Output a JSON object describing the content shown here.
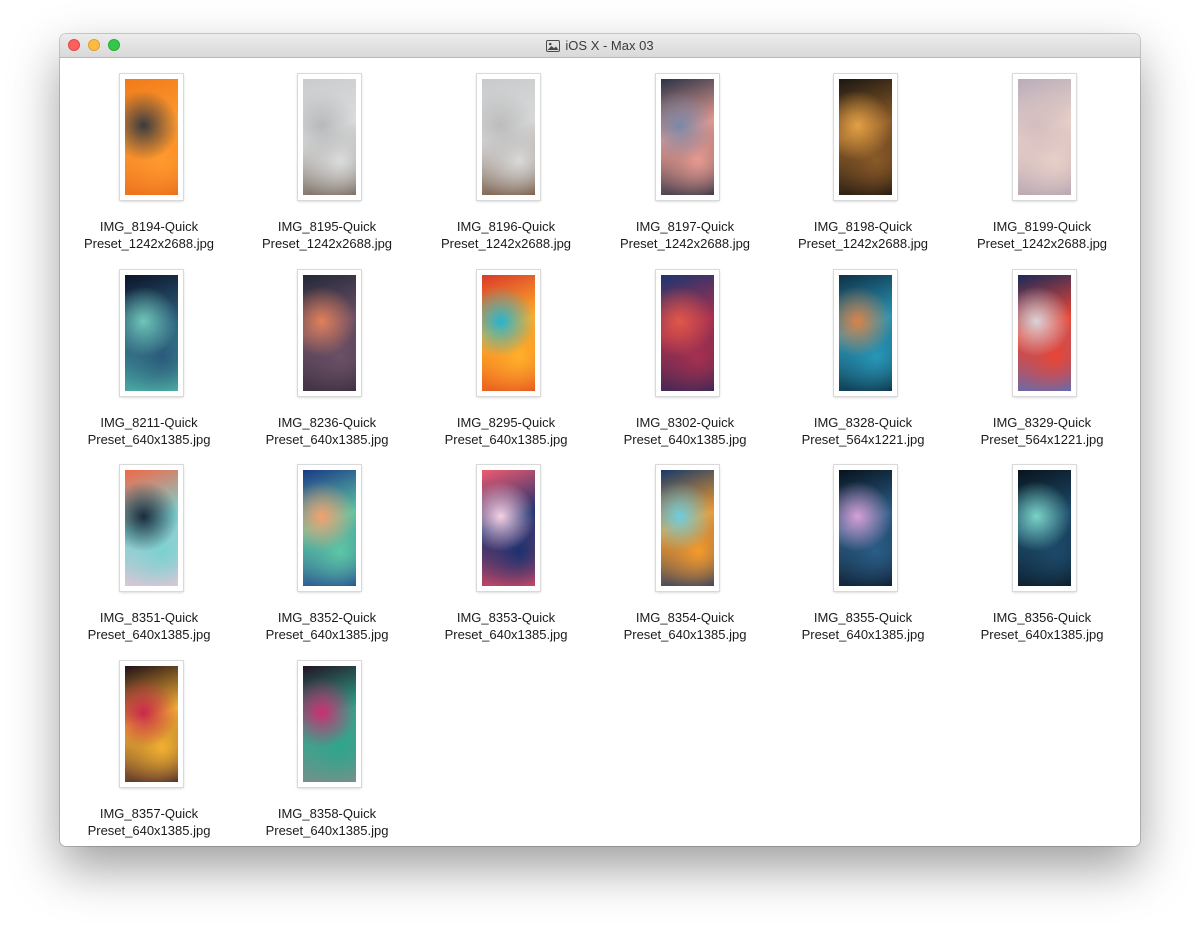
{
  "window": {
    "title": "iOS X - Max 03",
    "title_icon": "image-file-icon"
  },
  "items": [
    {
      "line1": "IMG_8194-Quick",
      "line2": "Preset_1242x2688.jpg",
      "colors": [
        "#f07a1a",
        "#ff9a2e",
        "#3a3a40",
        "#e8661a"
      ]
    },
    {
      "line1": "IMG_8195-Quick",
      "line2": "Preset_1242x2688.jpg",
      "colors": [
        "#c9cbcd",
        "#dadcdd",
        "#b8b9ba",
        "#6b5a4c"
      ]
    },
    {
      "line1": "IMG_8196-Quick",
      "line2": "Preset_1242x2688.jpg",
      "colors": [
        "#c8cacb",
        "#d8d9da",
        "#bcbcbc",
        "#6a4a32"
      ]
    },
    {
      "line1": "IMG_8197-Quick",
      "line2": "Preset_1242x2688.jpg",
      "colors": [
        "#2b3446",
        "#e69a90",
        "#7a88a8",
        "#1f2a3d"
      ]
    },
    {
      "line1": "IMG_8198-Quick",
      "line2": "Preset_1242x2688.jpg",
      "colors": [
        "#1c1712",
        "#8a5a28",
        "#e3a045",
        "#15110e"
      ]
    },
    {
      "line1": "IMG_8199-Quick",
      "line2": "Preset_1242x2688.jpg",
      "colors": [
        "#b9adba",
        "#e8cfc8",
        "#d3bdbf",
        "#ae9fae"
      ]
    },
    {
      "line1": "IMG_8211-Quick",
      "line2": "Preset_640x1385.jpg",
      "colors": [
        "#0c1428",
        "#2a5a7a",
        "#6fc6b9",
        "#54bfae"
      ]
    },
    {
      "line1": "IMG_8236-Quick",
      "line2": "Preset_640x1385.jpg",
      "colors": [
        "#232838",
        "#6b5066",
        "#e0805a",
        "#35293a"
      ]
    },
    {
      "line1": "IMG_8295-Quick",
      "line2": "Preset_640x1385.jpg",
      "colors": [
        "#d93a2a",
        "#ffb02a",
        "#27b3cf",
        "#e4481f"
      ]
    },
    {
      "line1": "IMG_8302-Quick",
      "line2": "Preset_640x1385.jpg",
      "colors": [
        "#1d3570",
        "#a6304f",
        "#e1574a",
        "#2c2657"
      ]
    },
    {
      "line1": "IMG_8328-Quick",
      "line2": "Preset_564x1221.jpg",
      "colors": [
        "#0e3147",
        "#2896b7",
        "#d8834a",
        "#0a2638"
      ]
    },
    {
      "line1": "IMG_8329-Quick",
      "line2": "Preset_564x1221.jpg",
      "colors": [
        "#1b2a59",
        "#e84535",
        "#d9d3d8",
        "#4a73c7"
      ]
    },
    {
      "line1": "IMG_8351-Quick",
      "line2": "Preset_640x1385.jpg",
      "colors": [
        "#f06848",
        "#7bd1d0",
        "#1a2b3c",
        "#f2c4d8"
      ]
    },
    {
      "line1": "IMG_8352-Quick",
      "line2": "Preset_640x1385.jpg",
      "colors": [
        "#1b3a86",
        "#5cc7a5",
        "#f2a070",
        "#24408f"
      ]
    },
    {
      "line1": "IMG_8353-Quick",
      "line2": "Preset_640x1385.jpg",
      "colors": [
        "#f05a70",
        "#1b3270",
        "#f6d0e4",
        "#ec4c62"
      ]
    },
    {
      "line1": "IMG_8354-Quick",
      "line2": "Preset_640x1385.jpg",
      "colors": [
        "#173a6b",
        "#f49a2c",
        "#6ccde0",
        "#1b3566"
      ]
    },
    {
      "line1": "IMG_8355-Quick",
      "line2": "Preset_640x1385.jpg",
      "colors": [
        "#07121e",
        "#2a5d86",
        "#d6a0d6",
        "#0b1624"
      ]
    },
    {
      "line1": "IMG_8356-Quick",
      "line2": "Preset_640x1385.jpg",
      "colors": [
        "#08141e",
        "#1d4a6a",
        "#7ad2c7",
        "#0a1721"
      ]
    },
    {
      "line1": "IMG_8357-Quick",
      "line2": "Preset_640x1385.jpg",
      "colors": [
        "#201018",
        "#f2b031",
        "#c8294b",
        "#3a1a2c"
      ]
    },
    {
      "line1": "IMG_8358-Quick",
      "line2": "Preset_640x1385.jpg",
      "colors": [
        "#221422",
        "#2fa58d",
        "#cc2f72",
        "#8a8a8a"
      ]
    }
  ]
}
